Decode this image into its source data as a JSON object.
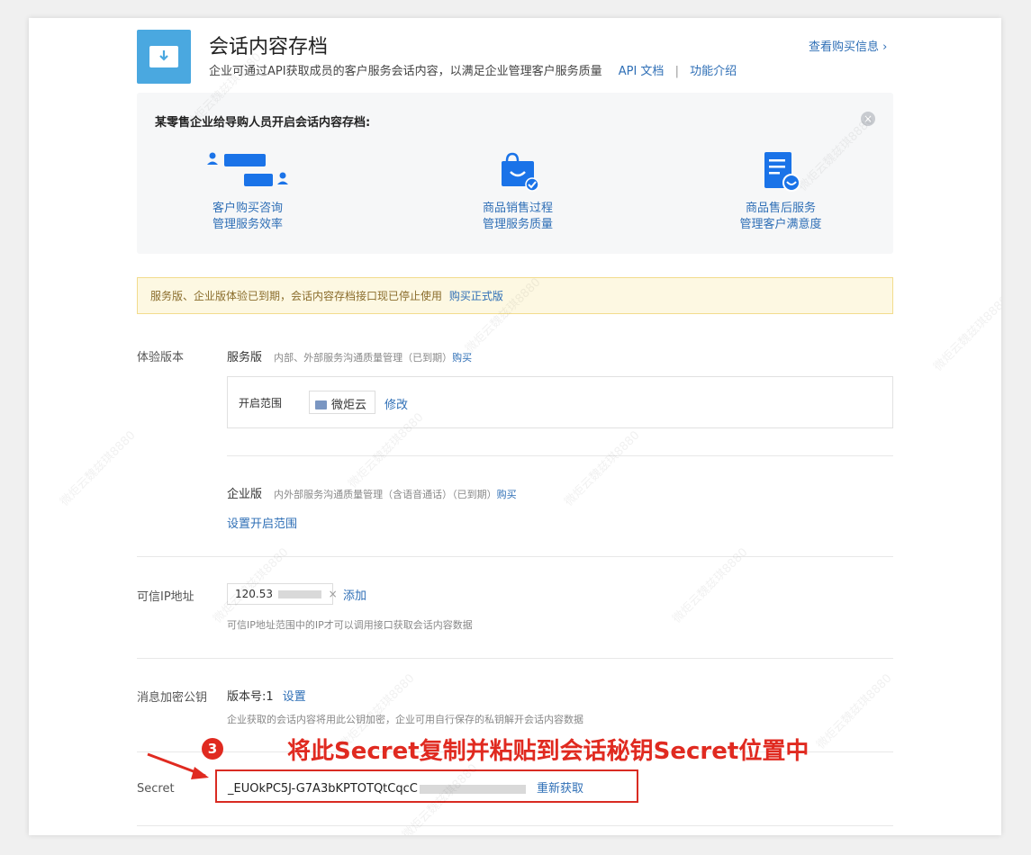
{
  "header": {
    "title": "会话内容存档",
    "subtitle": "企业可通过API获取成员的客户服务会话内容，以满足企业管理客户服务质量",
    "api_link": "API 文档",
    "separator": "|",
    "intro_link": "功能介绍",
    "purchase_link": "查看购买信息 ›"
  },
  "promo": {
    "title": "某零售企业给导购人员开启会话内容存档:",
    "close_icon": "×",
    "features": [
      {
        "icon": "chat-icon",
        "line1": "客户购买咨询",
        "line2": "管理服务效率"
      },
      {
        "icon": "shopping-bag-icon",
        "line1": "商品销售过程",
        "line2": "管理服务质量"
      },
      {
        "icon": "document-smile-icon",
        "line1": "商品售后服务",
        "line2": "管理客户满意度"
      }
    ]
  },
  "notice": {
    "text": "服务版、企业版体验已到期，会话内容存档接口现已停止使用",
    "link": "购买正式版"
  },
  "trial": {
    "label": "体验版本",
    "service": {
      "name": "服务版",
      "desc": "内部、外部服务沟通质量管理（已到期）",
      "buy": "购买",
      "scope_label": "开启范围",
      "scope_value": "微炬云",
      "edit": "修改"
    },
    "enterprise": {
      "name": "企业版",
      "desc": "内外部服务沟通质量管理（含语音通话）（已到期）",
      "buy": "购买",
      "set_scope": "设置开启范围"
    }
  },
  "ip": {
    "label": "可信IP地址",
    "value": "120.53",
    "add": "添加",
    "help": "可信IP地址范围中的IP才可以调用接口获取会话内容数据"
  },
  "key": {
    "label": "消息加密公钥",
    "version": "版本号:1",
    "set": "设置",
    "help": "企业获取的会话内容将用此公钥加密，企业可用自行保存的私钥解开会话内容数据"
  },
  "secret": {
    "label": "Secret",
    "value": "_EUOkPC5J-G7A3bKPTOTQtCqcC",
    "refresh": "重新获取"
  },
  "annotation": {
    "step": "3",
    "text": "将此Secret复制并粘贴到会话秘钥Secret位置中"
  },
  "watermark": "微炬云魏兹琪8880",
  "colors": {
    "accent": "#2f6fb6",
    "icon_blue": "#1a73e8",
    "annotation_red": "#e02a20",
    "notice_bg": "#fdf8e2"
  }
}
